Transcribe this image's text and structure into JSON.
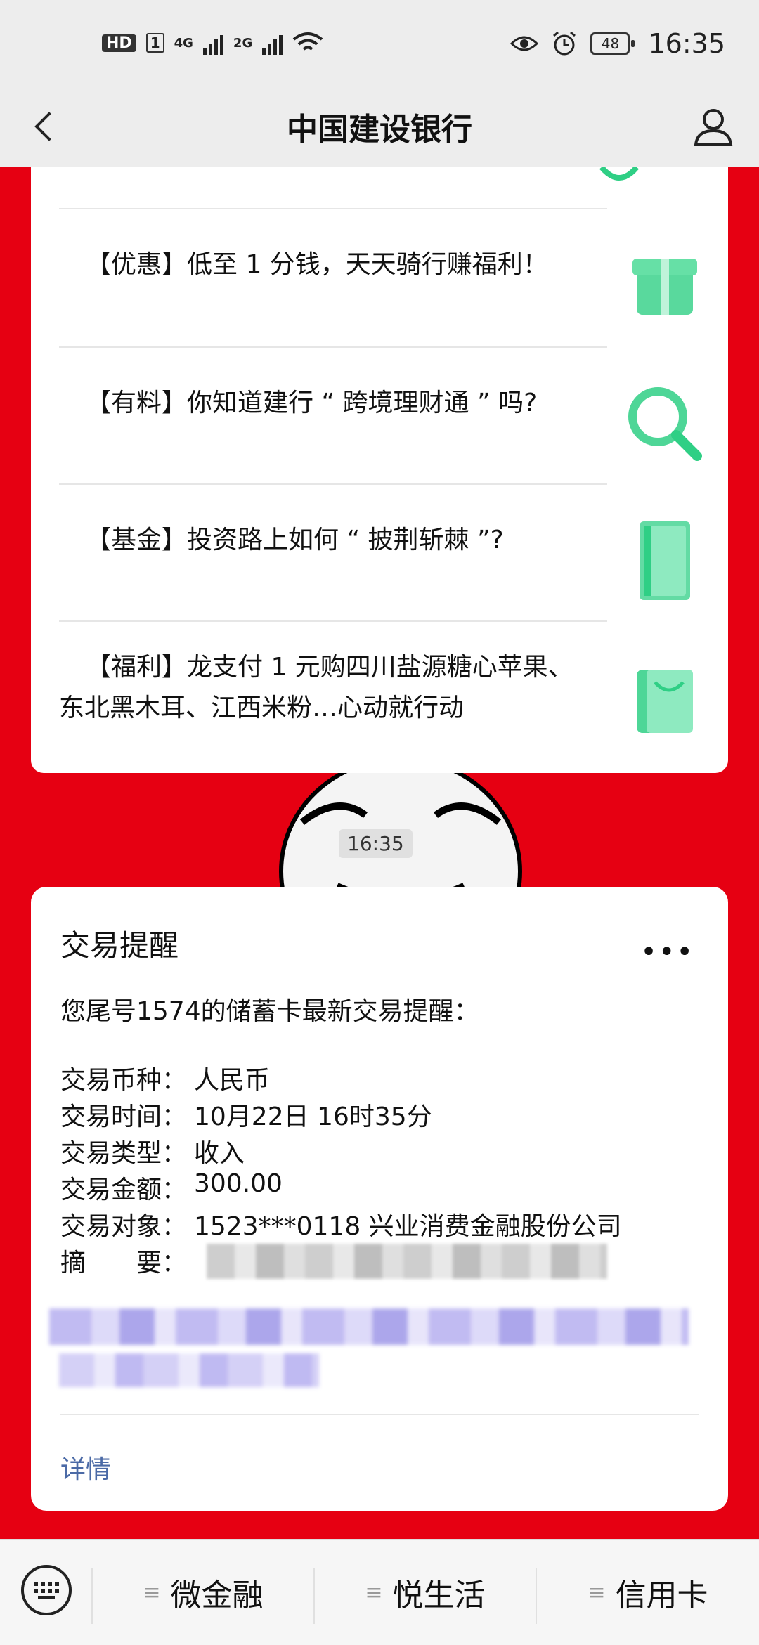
{
  "status": {
    "left_indicators": [
      "HD",
      "1",
      "4G",
      "2G"
    ],
    "battery": "48",
    "time": "16:35"
  },
  "nav": {
    "title": "中国建设银行"
  },
  "feed": {
    "items": [
      {
        "tag": "【优惠】",
        "text": "低至 1 分钱，天天骑行赚福利！",
        "thumb": "gift-icon"
      },
      {
        "tag": "【有料】",
        "text": "你知道建行 “ 跨境理财通 ” 吗?",
        "thumb": "magnifier-icon"
      },
      {
        "tag": "【基金】",
        "text": "投资路上如何 “ 披荆斩棘 ”?",
        "thumb": "book-icon"
      },
      {
        "tag": "【福利】",
        "text": "龙支付 1 元购四川盐源糖心苹果、",
        "text2": "东北黑木耳、江西米粉…心动就行动",
        "thumb": "shopping-bag-icon"
      }
    ]
  },
  "timestamp": "16:35",
  "notice": {
    "title": "交易提醒",
    "more": "•••",
    "intro": "您尾号1574的储蓄卡最新交易提醒：",
    "rows": [
      {
        "k": "交易币种：",
        "v": "人民币"
      },
      {
        "k": "交易时间：",
        "v": "10月22日 16时35分"
      },
      {
        "k": "交易类型：",
        "v": "收入"
      },
      {
        "k": "交易金额：",
        "v": "300.00"
      },
      {
        "k": "交易对象：",
        "v": "1523***0118 兴业消费金融股份公司"
      },
      {
        "k": "摘　　要：",
        "v": ""
      }
    ],
    "detail": "详情"
  },
  "menu": {
    "items": [
      "微金融",
      "悦生活",
      "信用卡"
    ],
    "hamburger": "≡"
  },
  "colors": {
    "background_red": "#e60012",
    "accent_green": "#2fcf85",
    "link_blue": "#4b6aa6"
  }
}
